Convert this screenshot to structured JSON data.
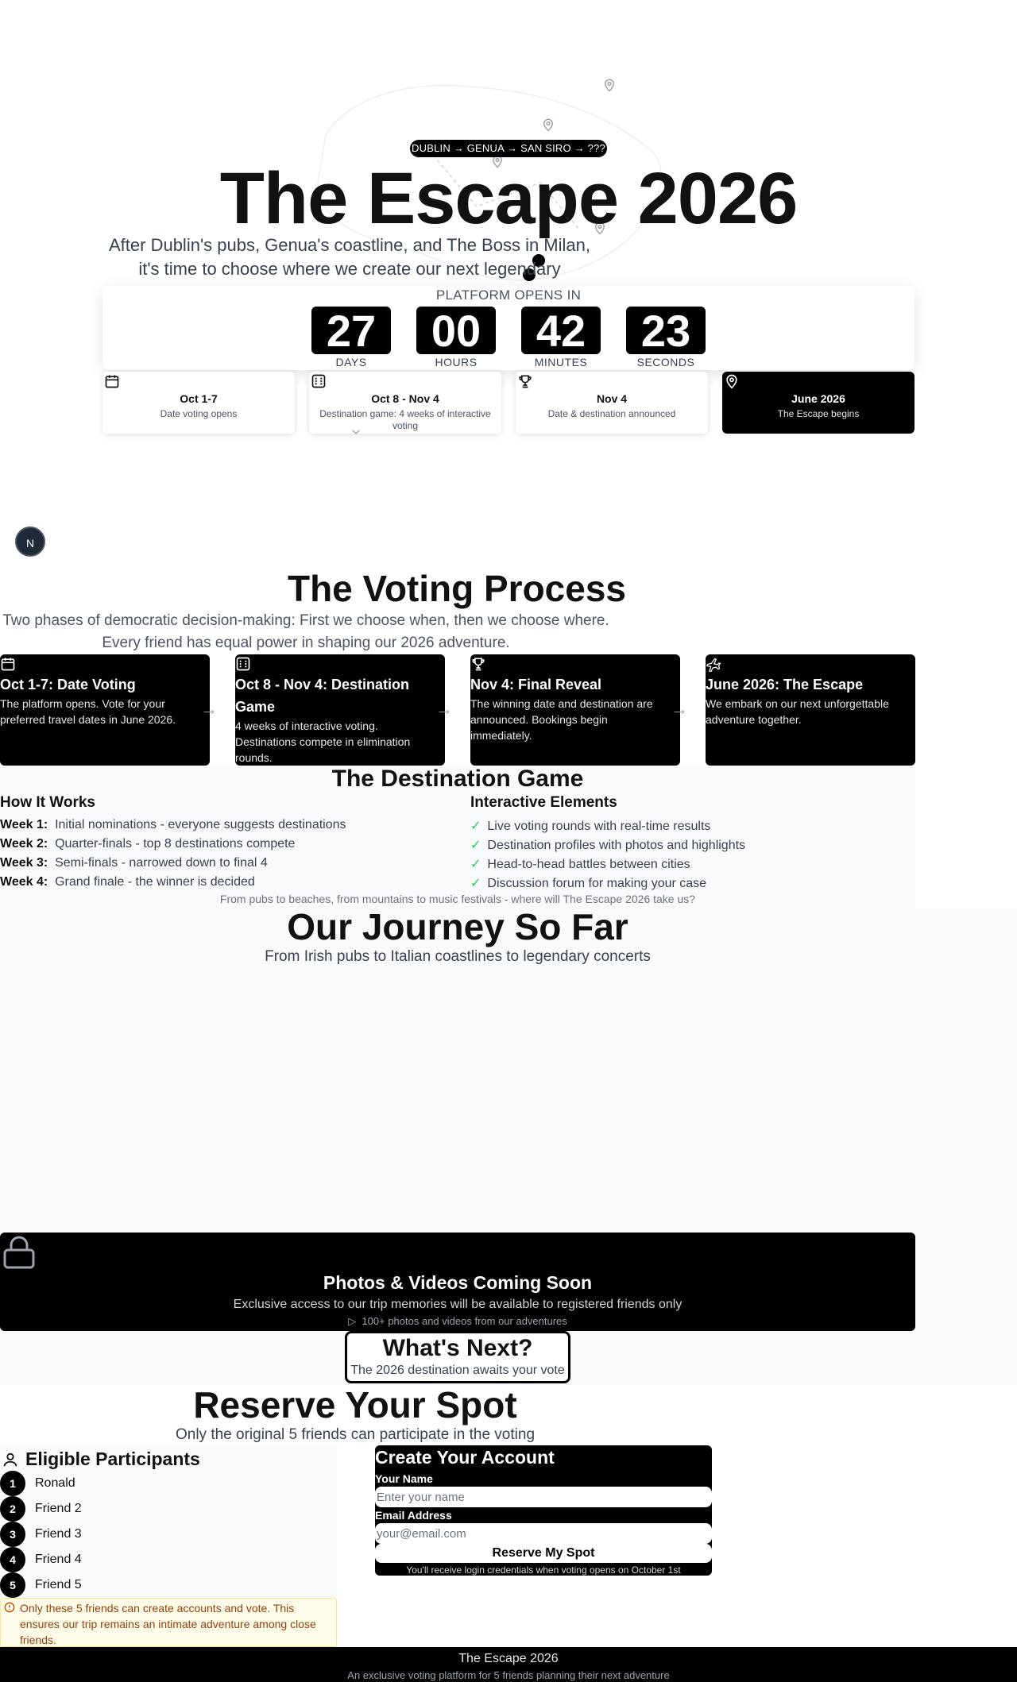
{
  "hero": {
    "route": "DUBLIN → GENUA → SAN SIRO → ???",
    "title": "The Escape 2026",
    "subtitle": "After Dublin's pubs, Genua's coastline, and The Boss in Milan, it's time to choose where we create our next legendary memories."
  },
  "countdown": {
    "label": "PLATFORM OPENS IN",
    "units": [
      {
        "value": "27",
        "label": "DAYS"
      },
      {
        "value": "00",
        "label": "HOURS"
      },
      {
        "value": "42",
        "label": "MINUTES"
      },
      {
        "value": "23",
        "label": "SECONDS"
      }
    ]
  },
  "timeline": [
    {
      "icon": "calendar-icon",
      "title": "Oct 1-7",
      "desc": "Date voting opens"
    },
    {
      "icon": "dice-icon",
      "title": "Oct 8 - Nov 4",
      "desc": "Destination game: 4 weeks of interactive voting"
    },
    {
      "icon": "trophy-icon",
      "title": "Nov 4",
      "desc": "Date & destination announced"
    },
    {
      "icon": "map-pin-icon",
      "title": "June 2026",
      "desc": "The Escape begins"
    }
  ],
  "badge": "N",
  "voting": {
    "title": "The Voting Process",
    "subtitle": "Two phases of democratic decision-making: First we choose when, then we choose where. Every friend has equal power in shaping our 2026 adventure.",
    "steps": [
      {
        "icon": "calendar-icon",
        "title": "Oct 1-7: Date Voting",
        "desc": "The platform opens. Vote for your preferred travel dates in June 2026."
      },
      {
        "icon": "dice-icon",
        "title": "Oct 8 - Nov 4: Destination Game",
        "desc": "4 weeks of interactive voting. Destinations compete in elimination rounds."
      },
      {
        "icon": "trophy-icon",
        "title": "Nov 4: Final Reveal",
        "desc": "The winning date and destination are announced. Bookings begin immediately."
      },
      {
        "icon": "plane-icon",
        "title": "June 2026: The Escape",
        "desc": "We embark on our next unforgettable adventure together."
      }
    ]
  },
  "game": {
    "title": "The Destination Game",
    "how_title": "How It Works",
    "weeks": [
      {
        "label": "Week 1:",
        "text": "Initial nominations - everyone suggests destinations"
      },
      {
        "label": "Week 2:",
        "text": "Quarter-finals - top 8 destinations compete"
      },
      {
        "label": "Week 3:",
        "text": "Semi-finals - narrowed down to final 4"
      },
      {
        "label": "Week 4:",
        "text": "Grand finale - the winner is decided"
      }
    ],
    "interactive_title": "Interactive Elements",
    "elements": [
      "Live voting rounds with real-time results",
      "Destination profiles with photos and highlights",
      "Head-to-head battles between cities",
      "Discussion forum for making your case"
    ],
    "footer": "From pubs to beaches, from mountains to music festivals - where will The Escape 2026 take us?"
  },
  "journey": {
    "title": "Our Journey So Far",
    "subtitle": "From Irish pubs to Italian coastlines to legendary concerts",
    "locked_title": "Photos & Videos Coming Soon",
    "locked_desc": "Exclusive access to our trip memories will be available to registered friends only",
    "media_count": "100+ photos and videos from our adventures",
    "next_title": "What's Next?",
    "next_desc": "The 2026 destination awaits your vote"
  },
  "reserve": {
    "title": "Reserve Your Spot",
    "subtitle": "Only the original 5 friends can participate in the voting",
    "participants_title": "Eligible Participants",
    "participants": [
      {
        "num": "1",
        "name": "Ronald"
      },
      {
        "num": "2",
        "name": "Friend 2"
      },
      {
        "num": "3",
        "name": "Friend 3"
      },
      {
        "num": "4",
        "name": "Friend 4"
      },
      {
        "num": "5",
        "name": "Friend 5"
      }
    ],
    "notice": "Only these 5 friends can create accounts and vote. This ensures our trip remains an intimate adventure among close friends.",
    "form": {
      "title": "Create Your Account",
      "name_label": "Your Name",
      "name_placeholder": "Enter your name",
      "email_label": "Email Address",
      "email_placeholder": "your@email.com",
      "submit": "Reserve My Spot",
      "note": "You'll receive login credentials when voting opens on October 1st"
    }
  },
  "footer": {
    "title": "The Escape 2026",
    "desc": "An exclusive voting platform for 5 friends planning their next adventure"
  }
}
